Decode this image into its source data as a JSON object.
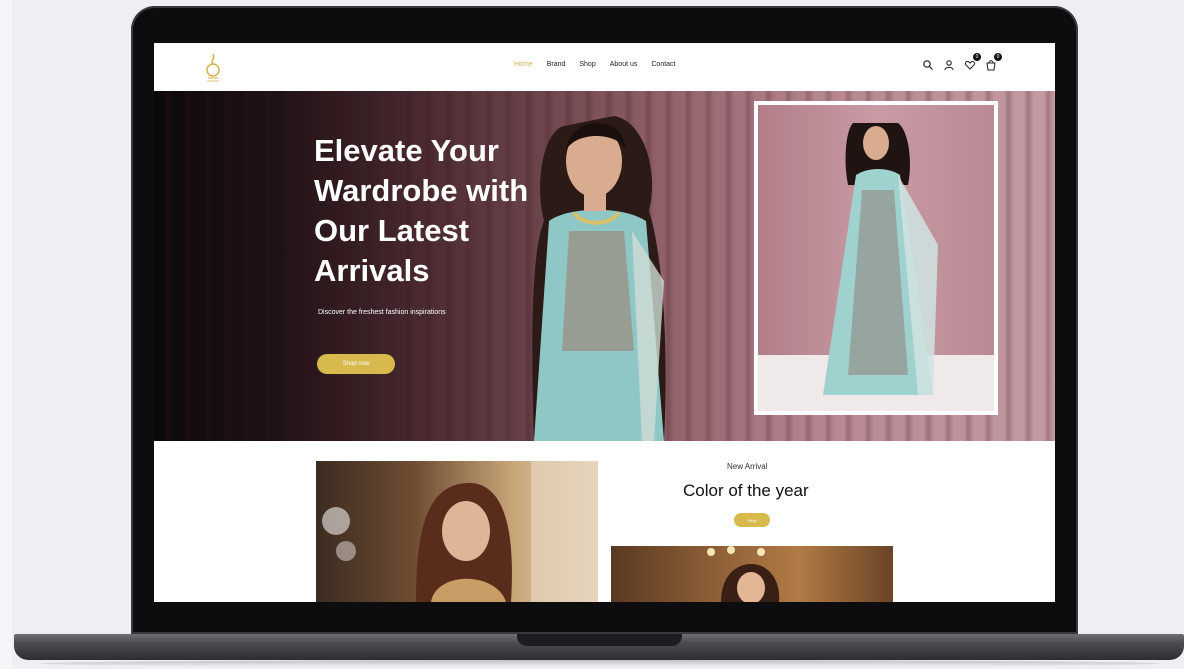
{
  "site": {
    "nav": [
      "Home",
      "Brand",
      "Shop",
      "About us",
      "Contact"
    ],
    "active_nav": "Home",
    "cart_count": "0",
    "wishlist_count": "0",
    "accent_color": "#d7b94e"
  },
  "hero": {
    "title": "Elevate Your\nWardrobe with\nOur Latest\nArrivals",
    "subtitle": "Discover the freshest fashion inspirations",
    "button": "Shop now"
  },
  "section": {
    "eyebrow": "New Arrival",
    "heading": "Color of the year",
    "button": "Shop"
  }
}
